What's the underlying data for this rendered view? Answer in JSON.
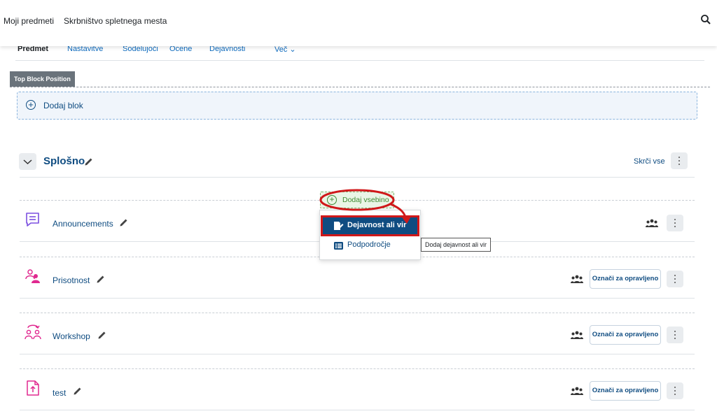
{
  "header": {
    "nav": [
      "Moji predmeti",
      "Skrbništvo spletnega mesta"
    ],
    "search_icon": "search-icon"
  },
  "tabs": [
    "Predmet",
    "Nastavitve",
    "Sodelujoči",
    "Ocene",
    "Dejavnosti",
    "Več ⌄"
  ],
  "block_region": {
    "badge": "Top Block Position",
    "add_block_label": "Dodaj blok"
  },
  "section": {
    "title": "Splošno",
    "collapse_all_label": "Skrči vse"
  },
  "add_content": {
    "label": "Dodaj vsebino",
    "menu": [
      "Dejavnost ali vir",
      "Podpodročje"
    ],
    "tooltip": "Dodaj dejavnost ali vir"
  },
  "activities": [
    {
      "name": "Announcements",
      "icon": "forum-icon",
      "completion_button": ""
    },
    {
      "name": "Prisotnost",
      "icon": "attendance-icon",
      "completion_button": "Označi za opravljeno"
    },
    {
      "name": "Workshop",
      "icon": "workshop-icon",
      "completion_button": "Označi za opravljeno"
    },
    {
      "name": "test",
      "icon": "file-upload-icon",
      "completion_button": "Označi za opravljeno"
    }
  ],
  "colors": {
    "primary": "#0f4c81",
    "annotation_red": "#d0181a",
    "forum_icon": "#7b4fe0",
    "activity_icon_pink": "#e0288f"
  }
}
